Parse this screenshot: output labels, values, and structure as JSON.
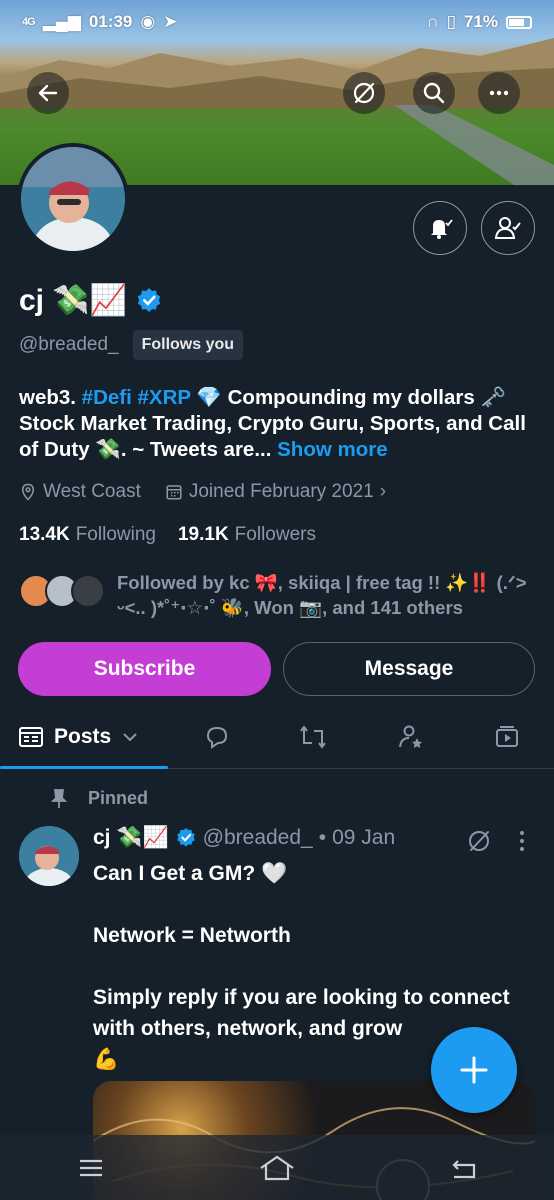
{
  "status": {
    "network": "4G",
    "time": "01:39",
    "battery": "71%"
  },
  "profile": {
    "name": "cj 💸📈",
    "handle": "@breaded_",
    "follows_you": "Follows you",
    "bio_prefix": "web3. ",
    "bio_tag1": "#Defi",
    "bio_tag2": "#XRP",
    "bio_rest": " 💎 Compounding my dollars 🗝️ Stock Market Trading, Crypto Guru, Sports, and Call of Duty 💸. ~ Tweets are... ",
    "show_more": "Show more",
    "location": "West Coast",
    "joined": "Joined February 2021",
    "following_count": "13.4K",
    "following_label": "Following",
    "followers_count": "19.1K",
    "followers_label": "Followers",
    "followed_by": "Followed by kc 🎀, skiiqa | free tag !! ✨‼️ (.ᐟ> ᵕ<.. )*˚⁺‧☆‧˚ 🐝, Won 📷, and 141 others"
  },
  "actions": {
    "subscribe": "Subscribe",
    "message": "Message"
  },
  "tabs": {
    "posts": "Posts"
  },
  "tweet": {
    "pinned_label": "Pinned",
    "name": "cj 💸📈",
    "handle": "@breaded_",
    "dot": "•",
    "date": "09 Jan",
    "line1": "Can I Get a GM? 🤍",
    "line2": "Network = Networth",
    "line3": "Simply reply if you are looking to connect with others, network, and grow",
    "line4": "💪"
  },
  "colors": {
    "background": "#15202b",
    "accent": "#1d9bf0",
    "subscribe": "#c43ed6",
    "muted": "#8b98a5"
  }
}
